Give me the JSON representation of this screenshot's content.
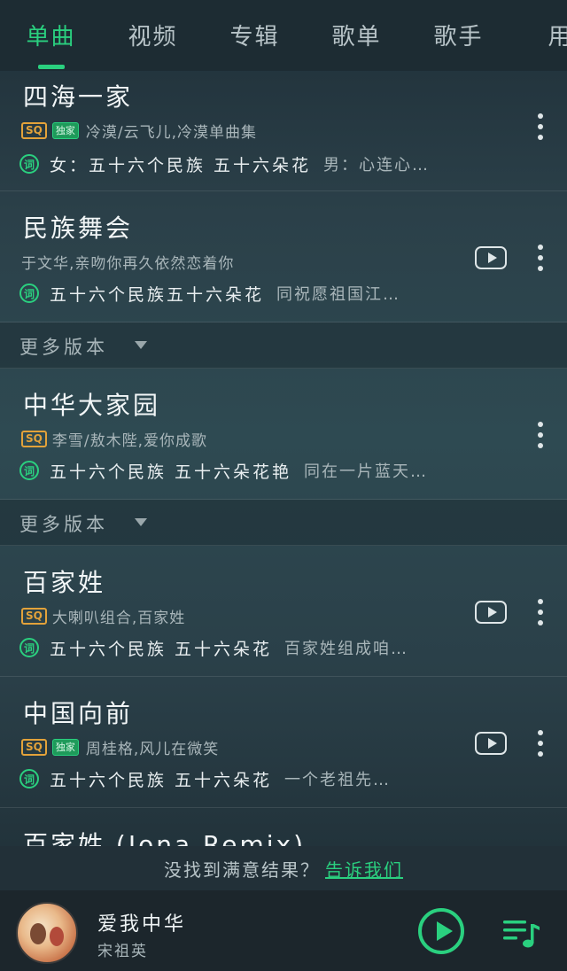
{
  "tabs": [
    {
      "label": "单曲",
      "active": true
    },
    {
      "label": "视频",
      "active": false
    },
    {
      "label": "专辑",
      "active": false
    },
    {
      "label": "歌单",
      "active": false
    },
    {
      "label": "歌手",
      "active": false
    },
    {
      "label": "用",
      "active": false
    }
  ],
  "songs": [
    {
      "title": "四海一家",
      "sq": "SQ",
      "exclusive": "独家",
      "artist": "冷漠/云飞儿,冷漠单曲集",
      "lyric_icon": "词",
      "lyric": "女：五十六个民族 五十六朵花",
      "lyric_more": "男：心连心…"
    },
    {
      "title": "民族舞会",
      "artist": "于文华,亲吻你再久依然恋着你",
      "lyric_icon": "词",
      "lyric": "五十六个民族五十六朵花",
      "lyric_more": "同祝愿祖国江…"
    },
    {
      "title": "中华大家园",
      "sq": "SQ",
      "artist": "李雪/敖木陛,爱你成歌",
      "lyric_icon": "词",
      "lyric": "五十六个民族 五十六朵花艳",
      "lyric_more": "同在一片蓝天…"
    },
    {
      "title": "百家姓",
      "sq": "SQ",
      "artist": "大喇叭组合,百家姓",
      "lyric_icon": "词",
      "lyric": "五十六个民族 五十六朵花",
      "lyric_more": "百家姓组成咱…"
    },
    {
      "title": "中国向前",
      "sq": "SQ",
      "exclusive": "独家",
      "artist": "周桂格,风儿在微笑",
      "lyric_icon": "词",
      "lyric": "五十六个民族 五十六朵花",
      "lyric_more": "一个老祖先…"
    },
    {
      "title": "百家姓 (Jona Remix)"
    }
  ],
  "more_versions_label": "更多版本",
  "feedback": {
    "question": "没找到满意结果？",
    "link": "告诉我们"
  },
  "now_playing": {
    "title": "爱我中华",
    "artist": "宋祖英"
  },
  "colors": {
    "accent": "#2ad07f",
    "sq_badge": "#e3a23a",
    "background": "#2b4049"
  }
}
